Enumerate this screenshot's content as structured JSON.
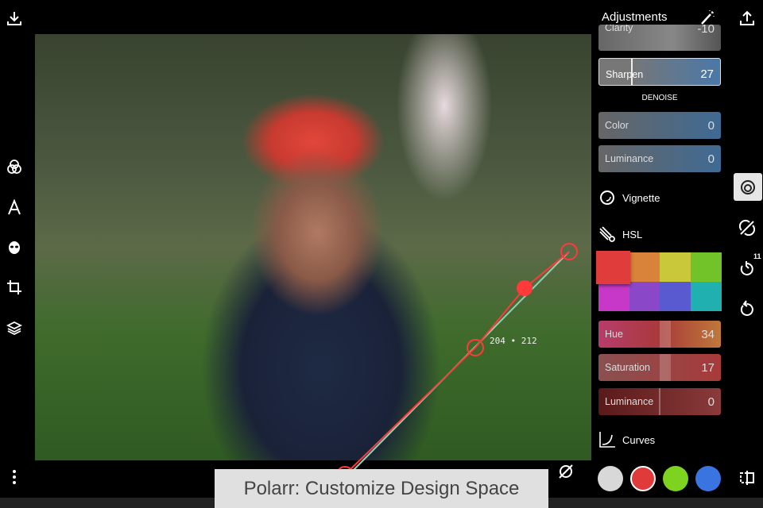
{
  "app": {
    "panel_title": "Adjustments",
    "caption": "Polarr: Customize Design Space"
  },
  "sliders": {
    "clarity": {
      "label": "Clarity",
      "value": "-10"
    },
    "sharpen": {
      "label": "Sharpen",
      "value": "27"
    },
    "denoise_header": "DENOISE",
    "denoise_color": {
      "label": "Color",
      "value": "0"
    },
    "denoise_luminance": {
      "label": "Luminance",
      "value": "0"
    },
    "hue": {
      "label": "Hue",
      "value": "34"
    },
    "saturation": {
      "label": "Saturation",
      "value": "17"
    },
    "luminance": {
      "label": "Luminance",
      "value": "0"
    }
  },
  "sections": {
    "vignette": "Vignette",
    "hsl": "HSL",
    "curves": "Curves"
  },
  "hsl_swatches": [
    "#e03c3c",
    "#d8823a",
    "#c8c83a",
    "#72c22a",
    "#c838c8",
    "#8a48c8",
    "#5a5ad0",
    "#20b0b0"
  ],
  "curve_channels": [
    "#d8d8d8",
    "#e03a3a",
    "#7ed321",
    "#3a74e0"
  ],
  "curve": {
    "readout": "204 • 212"
  },
  "history": {
    "count": "11"
  }
}
